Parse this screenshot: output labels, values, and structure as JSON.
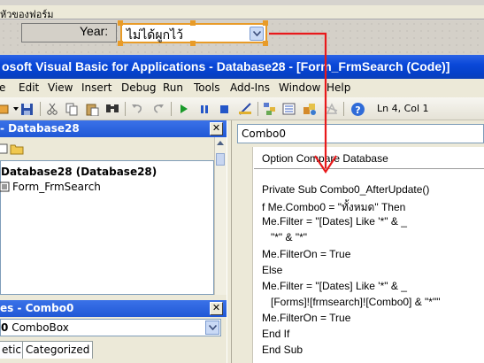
{
  "form": {
    "header_title": "หัวของฟอร์ม",
    "year_label": "Year:",
    "combo_value": "ไม่ได้ผูกไว้"
  },
  "vbe": {
    "title": "osoft Visual Basic for Applications - Database28 - [Form_FrmSearch (Code)]",
    "menu": [
      "Edit",
      "View",
      "Insert",
      "Debug",
      "Run",
      "Tools",
      "Add-Ins",
      "Window",
      "Help"
    ],
    "position": "Ln 4, Col 1"
  },
  "project": {
    "pane_title": "- Database28",
    "root": "Database28 (Database28)",
    "item": "Form_FrmSearch"
  },
  "properties": {
    "pane_title": "es - Combo0",
    "object_name": "0",
    "object_type": "ComboBox",
    "tabs": [
      "etic",
      "Categorized"
    ]
  },
  "code": {
    "object_combo": "Combo0",
    "option_line": "Option Compare Database",
    "lines": [
      "Private Sub Combo0_AfterUpdate()",
      "f Me.Combo0 = \"ทั้งหมด\" Then",
      "Me.Filter = \"[Dates] Like '*\" & _",
      "   \"*\" & \"*\"",
      "Me.FilterOn = True",
      "Else",
      "Me.Filter = \"[Dates] Like '*\" & _",
      "   [Forms]![frmsearch]![Combo0] & \"*\"\"",
      "Me.FilterOn = True",
      "End If",
      "End Sub"
    ]
  },
  "colors": {
    "accent_orange": "#e89b28",
    "arrow_red": "#e8191b",
    "title_blue": "#0a48d8"
  }
}
